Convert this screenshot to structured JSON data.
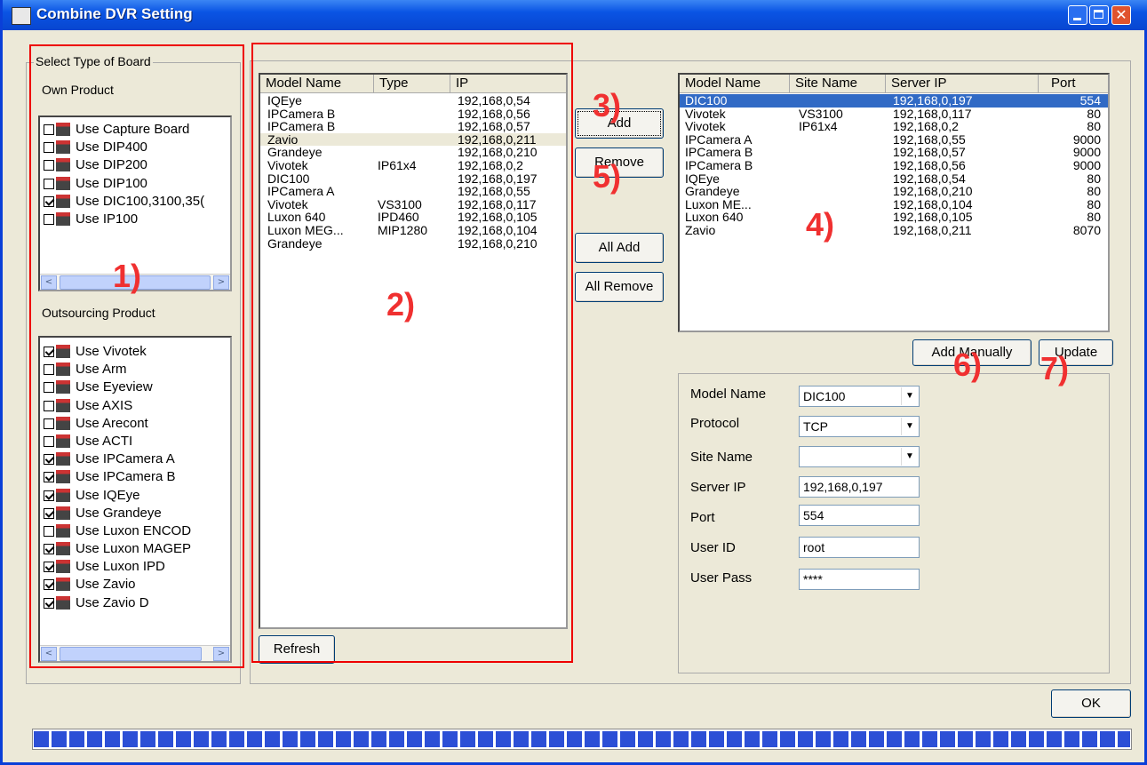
{
  "window": {
    "title": "Combine DVR Setting"
  },
  "board_group": {
    "label": "Select Type of Board",
    "own_label": "Own Product",
    "own_items": [
      {
        "label": "Use Capture Board",
        "checked": false
      },
      {
        "label": "Use DIP400",
        "checked": false
      },
      {
        "label": "Use DIP200",
        "checked": false
      },
      {
        "label": "Use DIP100",
        "checked": false
      },
      {
        "label": "Use DIC100,3100,35(",
        "checked": true
      },
      {
        "label": "Use IP100",
        "checked": false
      }
    ],
    "outsourcing_label": "Outsourcing Product",
    "outsourcing_items": [
      {
        "label": "Use Vivotek",
        "checked": true
      },
      {
        "label": "Use Arm",
        "checked": false
      },
      {
        "label": "Use Eyeview",
        "checked": false
      },
      {
        "label": "Use AXIS",
        "checked": false
      },
      {
        "label": "Use Arecont",
        "checked": false
      },
      {
        "label": "Use ACTI",
        "checked": false
      },
      {
        "label": "Use IPCamera A",
        "checked": true
      },
      {
        "label": "Use IPCamera B",
        "checked": true
      },
      {
        "label": "Use IQEye",
        "checked": true
      },
      {
        "label": "Use Grandeye",
        "checked": true
      },
      {
        "label": "Use Luxon ENCOD",
        "checked": false
      },
      {
        "label": "Use Luxon MAGEP",
        "checked": true
      },
      {
        "label": "Use Luxon IPD",
        "checked": true
      },
      {
        "label": "Use Zavio",
        "checked": true
      },
      {
        "label": "Use Zavio D",
        "checked": true
      }
    ]
  },
  "found_list": {
    "headers": [
      "Model Name",
      "Type",
      "IP"
    ],
    "rows": [
      [
        "IQEye",
        "",
        "192,168,0,54"
      ],
      [
        "IPCamera B",
        "",
        "192,168,0,56"
      ],
      [
        "IPCamera B",
        "",
        "192,168,0,57"
      ],
      [
        "Zavio",
        "",
        "192,168,0,211"
      ],
      [
        "Grandeye",
        "",
        "192,168,0,210"
      ],
      [
        "Vivotek",
        "IP61x4",
        "192,168,0,2"
      ],
      [
        "DIC100",
        "",
        "192,168,0,197"
      ],
      [
        "IPCamera A",
        "",
        "192,168,0,55"
      ],
      [
        "Vivotek",
        "VS3100",
        "192,168,0,117"
      ],
      [
        "Luxon 640",
        "IPD460",
        "192,168,0,105"
      ],
      [
        "Luxon MEG...",
        "MIP1280",
        "192,168,0,104"
      ],
      [
        "Grandeye",
        "",
        "192,168,0,210"
      ]
    ],
    "refresh_label": "Refresh"
  },
  "transfer_buttons": {
    "add": "Add",
    "remove": "Remove",
    "all_add": "All Add",
    "all_remove": "All Remove"
  },
  "added_list": {
    "headers": [
      "Model Name",
      "Site Name",
      "Server IP",
      "Port"
    ],
    "rows": [
      [
        "DIC100",
        "",
        "192,168,0,197",
        "554"
      ],
      [
        "Vivotek",
        "VS3100",
        "192,168,0,117",
        "80"
      ],
      [
        "Vivotek",
        "IP61x4",
        "192,168,0,2",
        "80"
      ],
      [
        "IPCamera A",
        "",
        "192,168,0,55",
        "9000"
      ],
      [
        "IPCamera B",
        "",
        "192,168,0,57",
        "9000"
      ],
      [
        "IPCamera B",
        "",
        "192,168,0,56",
        "9000"
      ],
      [
        "IQEye",
        "",
        "192,168,0,54",
        "80"
      ],
      [
        "Grandeye",
        "",
        "192,168,0,210",
        "80"
      ],
      [
        "Luxon ME...",
        "",
        "192,168,0,104",
        "80"
      ],
      [
        "Luxon 640",
        "",
        "192,168,0,105",
        "80"
      ],
      [
        "Zavio",
        "",
        "192,168,0,211",
        "8070"
      ]
    ],
    "add_manually_label": "Add Manually",
    "update_label": "Update"
  },
  "detail_form": {
    "model_name_label": "Model Name",
    "model_name_value": "DIC100",
    "protocol_label": "Protocol",
    "protocol_value": "TCP",
    "site_name_label": "Site Name",
    "site_name_value": "",
    "server_ip_label": "Server IP",
    "server_ip_value": "192,168,0,197",
    "port_label": "Port",
    "port_value": "554",
    "user_id_label": "User ID",
    "user_id_value": "root",
    "user_pass_label": "User Pass",
    "user_pass_value": "****"
  },
  "ok_label": "OK",
  "annotations": {
    "a1": "1)",
    "a2": "2)",
    "a3": "3)",
    "a4": "4)",
    "a5": "5)",
    "a6": "6)",
    "a7": "7)"
  },
  "progress": {
    "fraction": 1.0
  },
  "colors": {
    "title_bar": "#0a54e4",
    "selection": "#316ac5",
    "annotation": "#f03030",
    "progress": "#2c4fd6"
  }
}
